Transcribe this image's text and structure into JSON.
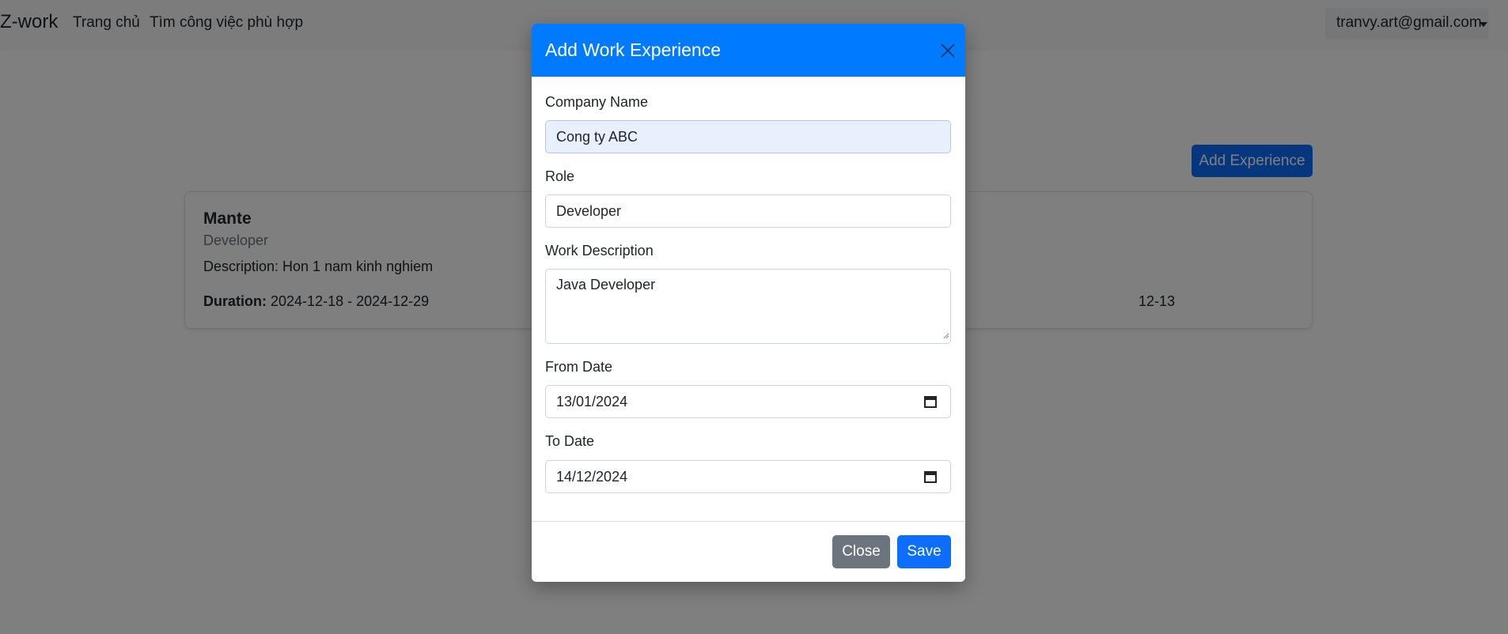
{
  "navbar": {
    "brand": "Z-work",
    "links": [
      {
        "label": "Trang chủ"
      },
      {
        "label": "Tìm công việc phù hợp"
      }
    ],
    "user_email": "tranvy.art@gmail.com"
  },
  "page": {
    "add_experience_label": "Add Experience",
    "cards": [
      {
        "company": "Mante",
        "role": "Developer",
        "description": "Description: Hon 1 nam kinh nghiem",
        "duration_label": "Duration:",
        "duration_value": "2024-12-18 - 2024-12-29"
      },
      {
        "duration_partial": "12-13"
      }
    ]
  },
  "modal": {
    "title": "Add Work Experience",
    "fields": {
      "company_name": {
        "label": "Company Name",
        "value": "Cong ty ABC"
      },
      "role": {
        "label": "Role",
        "value": "Developer"
      },
      "work_description": {
        "label": "Work Description",
        "value": "Java Developer"
      },
      "from_date": {
        "label": "From Date",
        "value": "13/01/2024"
      },
      "to_date": {
        "label": "To Date",
        "value": "14/12/2024"
      }
    },
    "close_label": "Close",
    "save_label": "Save"
  },
  "colors": {
    "primary": "#0d6efd",
    "header": "#007bff",
    "secondary": "#6c757d"
  }
}
